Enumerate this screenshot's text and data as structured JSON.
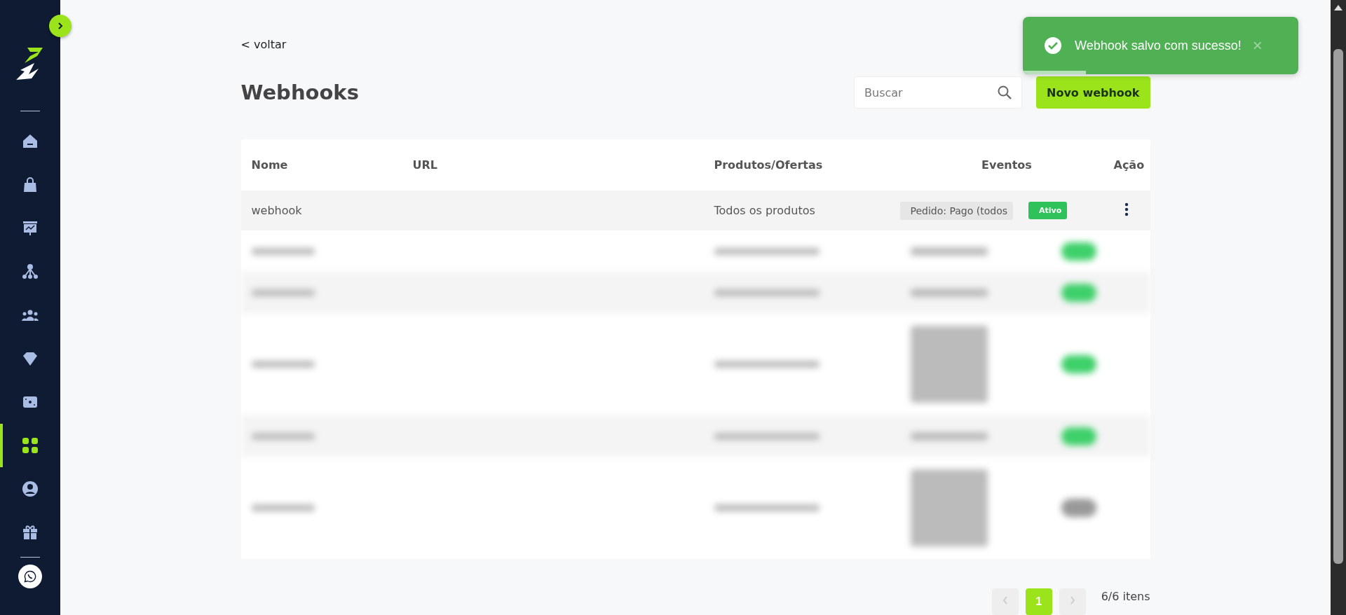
{
  "sidebar": {
    "items": [
      {
        "selected": false
      },
      {
        "selected": false
      },
      {
        "selected": false
      },
      {
        "selected": false
      },
      {
        "selected": false
      },
      {
        "selected": false
      },
      {
        "selected": false
      },
      {
        "selected": true
      },
      {
        "selected": false
      },
      {
        "selected": false
      }
    ]
  },
  "back_link": "< voltar",
  "title": "Webhooks",
  "search": {
    "placeholder": "Buscar"
  },
  "new_button": "Novo webhook",
  "toast": {
    "message": "Webhook salvo com sucesso!",
    "close": "×",
    "level": 0.23
  },
  "table": {
    "columns": [
      "Nome",
      "URL",
      "Produtos/Ofertas",
      "Eventos",
      "Ação"
    ],
    "rows": [
      {
        "name": "webhook",
        "url": "",
        "products": "Todos os produtos",
        "event": "Pedido: Pago (todos",
        "status": "Ativo"
      }
    ],
    "hidden_rows": [
      {
        "kind": "single"
      },
      {
        "kind": "single"
      },
      {
        "kind": "multi"
      },
      {
        "kind": "single"
      },
      {
        "kind": "multimuted"
      }
    ]
  },
  "pagination": {
    "pages": [
      {
        "label": "1",
        "selected": true
      }
    ],
    "count": "6/6 itens"
  }
}
